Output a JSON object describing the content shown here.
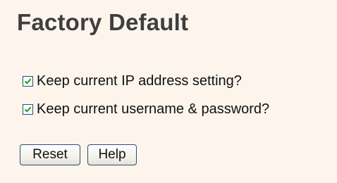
{
  "page": {
    "title": "Factory Default"
  },
  "options": {
    "keep_ip": {
      "label": "Keep current IP address setting?",
      "checked": true
    },
    "keep_user": {
      "label": "Keep current username & password?",
      "checked": true
    }
  },
  "buttons": {
    "reset_label": "Reset",
    "help_label": "Help"
  },
  "colors": {
    "background": "#fdf5ec",
    "checkmark": "#1f9a2a",
    "checkbox_border": "#1c5180"
  }
}
